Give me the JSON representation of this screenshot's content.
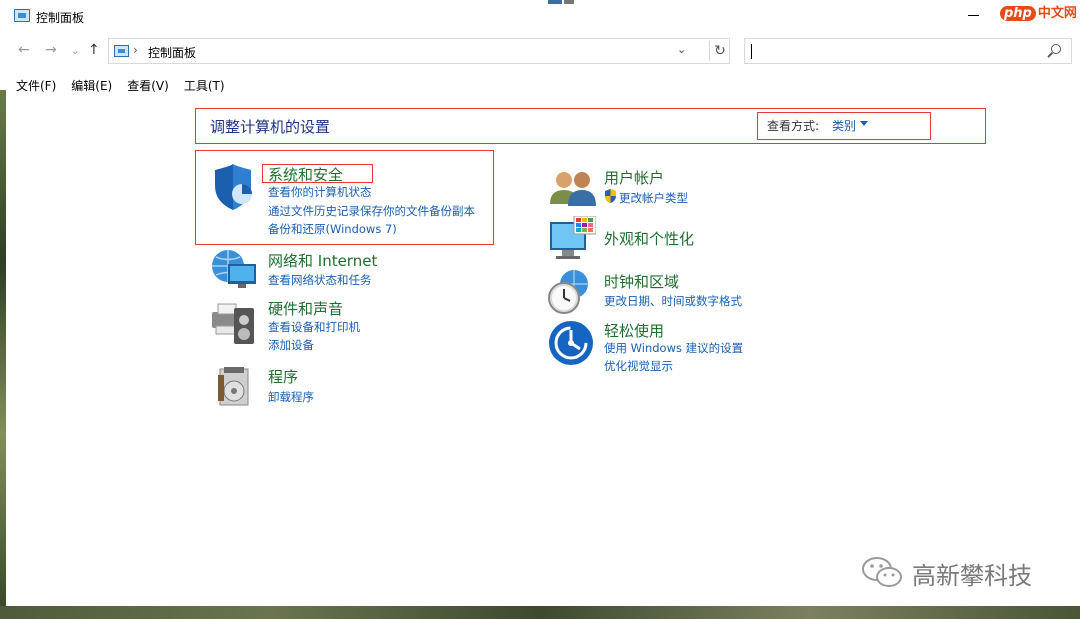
{
  "window": {
    "title": "控制面板",
    "watermark_php": "php",
    "watermark_cn": "中文网"
  },
  "address": {
    "path": "控制面板",
    "separator": "›"
  },
  "menu": [
    "文件(F)",
    "编辑(E)",
    "查看(V)",
    "工具(T)"
  ],
  "main": {
    "title": "调整计算机的设置",
    "view_by_label": "查看方式:",
    "view_by_value": "类别"
  },
  "categories": {
    "system_security": {
      "title": "系统和安全",
      "links": [
        "查看你的计算机状态",
        "通过文件历史记录保存你的文件备份副本",
        "备份和还原(Windows 7)"
      ]
    },
    "network": {
      "title": "网络和 Internet",
      "links": [
        "查看网络状态和任务"
      ]
    },
    "hardware": {
      "title": "硬件和声音",
      "links": [
        "查看设备和打印机",
        "添加设备"
      ]
    },
    "programs": {
      "title": "程序",
      "links": [
        "卸载程序"
      ]
    },
    "user_accounts": {
      "title": "用户帐户",
      "links": [
        "更改帐户类型"
      ]
    },
    "appearance": {
      "title": "外观和个性化",
      "links": []
    },
    "clock_region": {
      "title": "时钟和区域",
      "links": [
        "更改日期、时间或数字格式"
      ]
    },
    "ease_of_access": {
      "title": "轻松使用",
      "links": [
        "使用 Windows 建议的设置",
        "优化视觉显示"
      ]
    }
  },
  "watermark": {
    "text": "高新攀科技"
  },
  "colors": {
    "highlight_box": "#e53935",
    "category_title": "#1f6f2f",
    "link": "#1a5fb4",
    "heading": "#1e3287"
  }
}
